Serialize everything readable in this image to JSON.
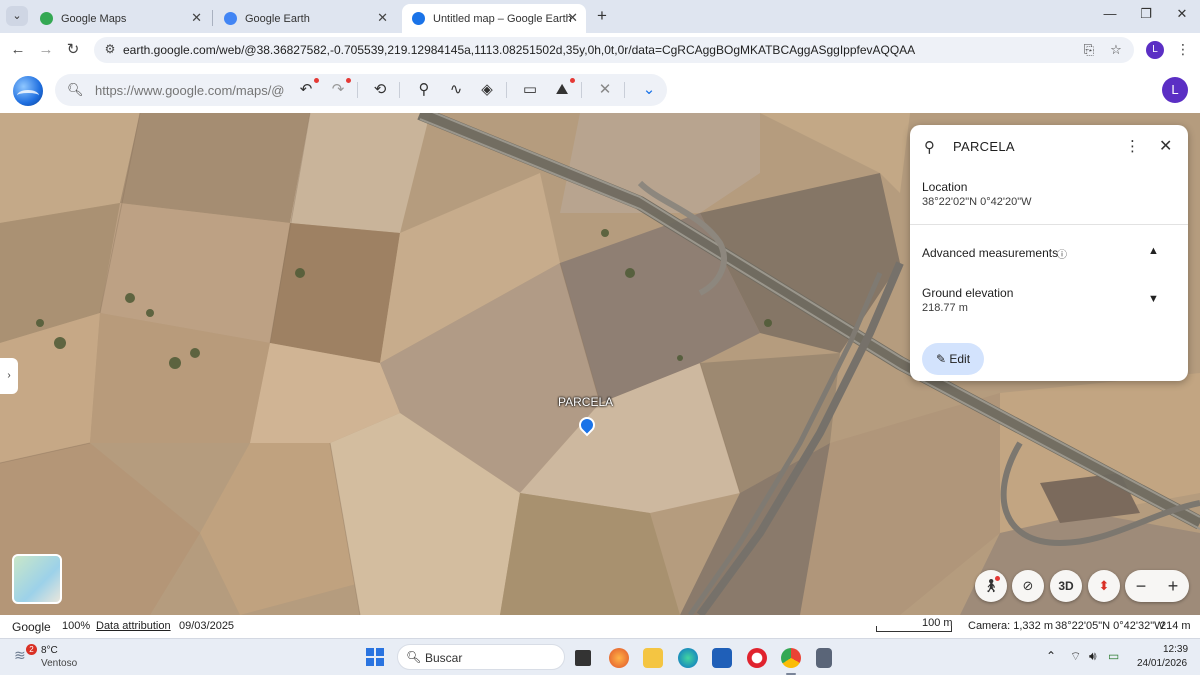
{
  "browser": {
    "tabs": [
      {
        "title": "Google Maps",
        "favicon_color": "#34a853"
      },
      {
        "title": "Google Earth",
        "favicon_color": "#4285f4"
      },
      {
        "title": "Untitled map – Google Earth",
        "favicon_color": "#1a73e8"
      }
    ],
    "new_tab_symbol": "+",
    "window_controls": {
      "minimize": "—",
      "restore": "❐",
      "close": "✕"
    },
    "url": "earth.google.com/web/@38.36827582,-0.705539,219.12984145a,1113.08251502d,35y,0h,0t,0r/data=CgRCAggBOgMKATBCAggASggIppfevAQQAA",
    "profile_initial": "L"
  },
  "earth_toolbar": {
    "search_placeholder": "https://www.google.com/maps/@",
    "tools": [
      "undo-icon",
      "redo-icon",
      "history-icon",
      "add-placemark-icon",
      "draw-path-icon",
      "layers-icon",
      "measure-icon",
      "elevation-icon",
      "settings-tools-icon",
      "chevron-down-icon"
    ],
    "user_initial": "L"
  },
  "map": {
    "placemark_label": "PARCELA",
    "controls": {
      "three_d_label": "3D"
    }
  },
  "info_panel": {
    "title": "PARCELA",
    "location_label": "Location",
    "location_value": "38°22'02\"N 0°42'20\"W",
    "advanced_label": "Advanced measurements",
    "elevation_label": "Ground elevation",
    "elevation_value": "218.77 m",
    "edit_label": "Edit"
  },
  "status_bar": {
    "brand": "Google",
    "zoom": "100%",
    "attribution": "Data attribution",
    "imagery_date": "09/03/2025",
    "scale": "100 m",
    "camera": "Camera: 1,332 m",
    "coordinates": "38°22'05\"N 0°42'32\"W",
    "altitude": "214 m"
  },
  "taskbar": {
    "weather_badge": "2",
    "weather_temp": "8°C",
    "weather_desc": "Ventoso",
    "search_label": "Buscar",
    "time": "12:39",
    "date": "24/01/2026"
  }
}
